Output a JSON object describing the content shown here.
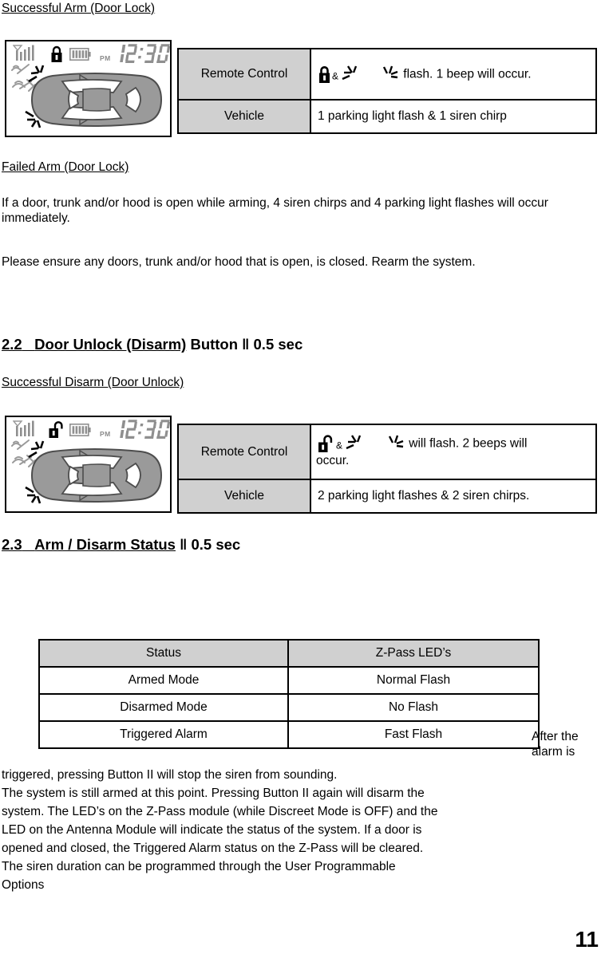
{
  "document": {
    "page_number": "11"
  },
  "sections": {
    "arm_heading": "Successful Arm (Door Lock)",
    "failed_heading": "Failed Arm (Door Lock)",
    "failed_para_1": "If a door, trunk and/or hood is open while arming, 4 siren chirps and 4 parking light flashes will occur immediately.",
    "failed_para_2": "Please ensure any doors, trunk and/or hood that is open, is closed.  Rearm the system.",
    "sec22_number": "2.2",
    "sec22_title": "Door Unlock (Disarm)",
    "sec22_rest": "Button  ǁ   0.5 sec",
    "disarm_heading": "Successful Disarm (Door Unlock)",
    "sec23_number": "2.3",
    "sec23_title": "Arm / Disarm Status",
    "sec23_rest": "ǁ    0.5 sec"
  },
  "lcd_display": {
    "time": "12:30",
    "meridiem": "PM",
    "icons_locked": [
      "signal-bars-icon",
      "radio-waves-icon",
      "padlock-closed-icon",
      "battery-icon",
      "car-top-view-icon",
      "parking-light-flash-icon"
    ],
    "icons_unlocked": [
      "signal-bars-icon",
      "radio-waves-icon",
      "padlock-open-icon",
      "battery-icon",
      "car-top-view-icon",
      "parking-light-flash-icon"
    ]
  },
  "arm_table": {
    "row1_label": "Remote Control",
    "row1_amp": "&",
    "row1_text": "flash.  1 beep will occur.",
    "row1_lock_icon": "padlock-closed-icon",
    "row2_label": "Vehicle",
    "row2_text": "1 parking light flash & 1 siren chirp"
  },
  "disarm_table": {
    "row1_label": "Remote Control",
    "row1_amp": "&",
    "row1_text": "will flash.  2 beeps will",
    "row1_text_line2": "occur.",
    "row1_lock_icon": "padlock-open-icon",
    "row2_label": "Vehicle",
    "row2_text": "2 parking light flashes & 2 siren chirps."
  },
  "status_table": {
    "headers": [
      "Status",
      "Z-Pass LED’s"
    ],
    "rows": [
      [
        "Armed Mode",
        "Normal Flash"
      ],
      [
        "Disarmed Mode",
        "No Flash"
      ],
      [
        "Triggered Alarm",
        "Fast Flash"
      ]
    ]
  },
  "closing_text": {
    "wrap_note": "After the alarm is",
    "line_1": "triggered, pressing Button II will stop the siren from sounding.",
    "line_2": "The system is still armed at this point.  Pressing Button II again will disarm the",
    "line_3": "system.  The LED’s on the Z-Pass module (while Discreet Mode is OFF) and the",
    "line_4": "LED on the Antenna Module will indicate the status of the system.  If a door is",
    "line_5": "opened and closed, the Triggered Alarm status on the Z-Pass will be cleared.",
    "line_6": "The siren duration can be programmed through the User Programmable",
    "line_7": "Options"
  },
  "colors": {
    "header_gray": "#d0d0d0",
    "lcd_gray": "#8a8a8a",
    "car_gray": "#999999",
    "black": "#000000"
  }
}
